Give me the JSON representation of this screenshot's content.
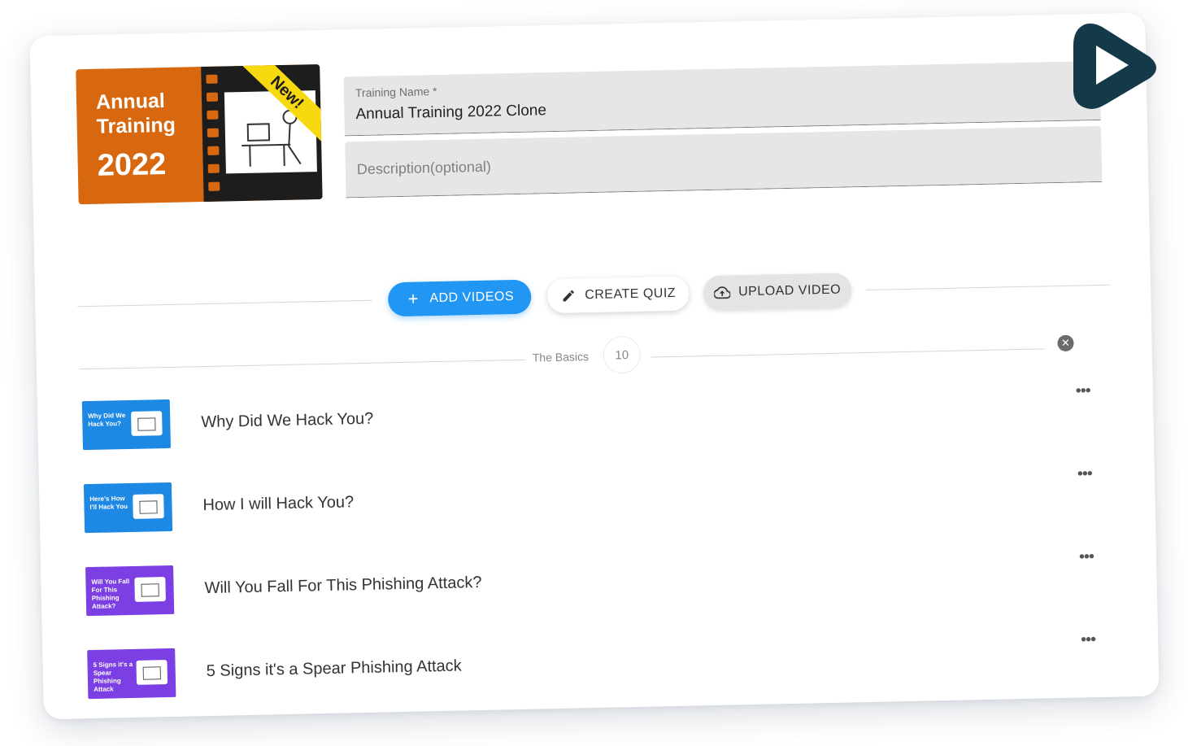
{
  "training": {
    "thumbnail": {
      "title": "Annual Training",
      "year": "2022",
      "badge": "New!",
      "colors": {
        "background": "#d7680f",
        "film": "#1d1d1d",
        "badge": "#f7d90f"
      }
    },
    "name_label": "Training Name *",
    "name_value": "Annual Training 2022 Clone",
    "description_placeholder": "Description(optional)"
  },
  "toolbar": {
    "add_videos": "ADD VIDEOS",
    "create_quiz": "CREATE QUIZ",
    "upload_video": "UPLOAD VIDEO",
    "icons": {
      "add": "plus-icon",
      "quiz": "pencil-icon",
      "upload": "cloud-upload-icon"
    },
    "accent": "#2196f3"
  },
  "section": {
    "label": "The Basics",
    "count": "10"
  },
  "videos": [
    {
      "title": "Why Did We Hack You?",
      "thumb_text": "Why Did We Hack You?",
      "thumb_color": "#1e88e5"
    },
    {
      "title": "How I will Hack You?",
      "thumb_text": "Here's How I'll Hack You",
      "thumb_color": "#1e88e5"
    },
    {
      "title": "Will You Fall For This Phishing Attack?",
      "thumb_text": "Will You Fall For This Phishing Attack?",
      "thumb_color": "#7b3fe4"
    },
    {
      "title": "5 Signs it's a Spear Phishing Attack",
      "thumb_text": "5 Signs it's a Spear Phishing Attack",
      "thumb_color": "#7b3fe4"
    }
  ],
  "brand": {
    "logo_icon": "play-logo-icon",
    "color": "#143a4a"
  }
}
